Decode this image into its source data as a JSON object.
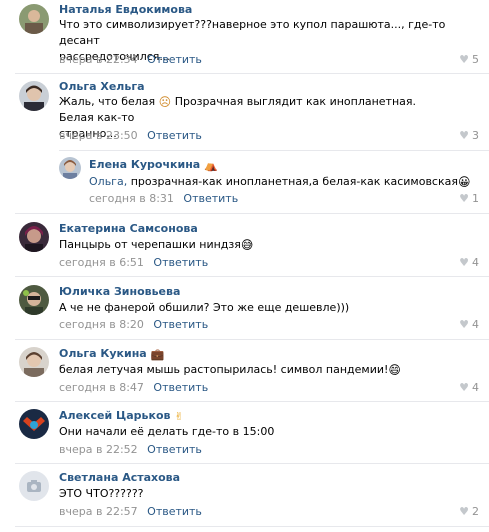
{
  "comments": [
    {
      "author": "Наталья Евдокимова",
      "badge": "",
      "text": "Что это символизирует???наверное это купол парашюта..., где-то десант",
      "text2": "рассредоточился...",
      "time": "вчера в 22:54",
      "reply_label": "Ответить",
      "likes": "5"
    },
    {
      "author": "Ольга Хельга",
      "badge": "",
      "text": "Жаль, что белая",
      "emoji": "☹",
      "text_after": "Прозрачная выглядит как инопланетная. Белая как-то",
      "text2": "странно...",
      "time": "вчера в 23:50",
      "reply_label": "Ответить",
      "likes": "3"
    },
    {
      "author": "Елена Курочкина",
      "badge": "⛺",
      "mention": "Ольга,",
      "text": "прозрачная-как инопланетная,а белая-как касимовская",
      "emoji": "😀",
      "time": "сегодня в 8:31",
      "reply_label": "Ответить",
      "likes": "1"
    },
    {
      "author": "Екатерина Самсонова",
      "badge": "",
      "text": "Панцырь от черепашки ниндзя",
      "emoji": "😅",
      "time": "сегодня в 6:51",
      "reply_label": "Ответить",
      "likes": "4"
    },
    {
      "author": "Юличка Зиновьева",
      "badge": "",
      "text": "А че не фанерой обшили? Это же еще дешевле)))",
      "time": "сегодня в 8:20",
      "reply_label": "Ответить",
      "likes": "4"
    },
    {
      "author": "Ольга Кукина",
      "badge": "💼",
      "text": "белая летучая мышь растопырилась! символ пандемии!",
      "emoji": "😄",
      "time": "сегодня в 8:47",
      "reply_label": "Ответить",
      "likes": "4"
    },
    {
      "author": "Алексей Царьков",
      "badge": "✌",
      "text": "Они начали её делать где-то в 15:00",
      "time": "вчера в 22:52",
      "reply_label": "Ответить",
      "likes": ""
    },
    {
      "author": "Светлана Астахова",
      "badge": "",
      "text": "ЭТО ЧТО??????",
      "time": "вчера в 22:57",
      "reply_label": "Ответить",
      "likes": "2"
    }
  ]
}
